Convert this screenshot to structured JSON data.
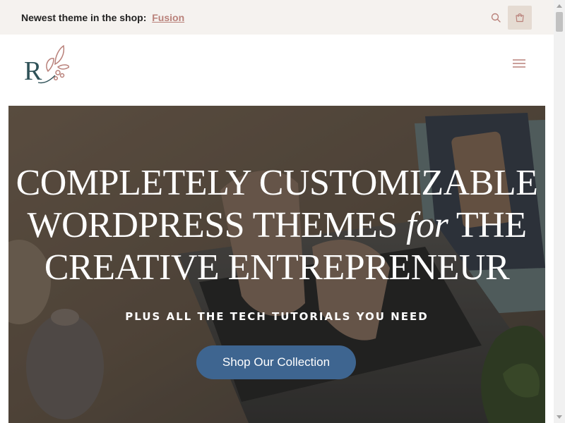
{
  "announcement": {
    "text": "Newest theme in the shop:",
    "link_label": "Fusion"
  },
  "header": {
    "search_icon": "search-icon",
    "cart_icon": "cart-icon",
    "menu_icon": "hamburger-menu-icon",
    "logo_letter": "R"
  },
  "hero": {
    "title_line1": "COMPLETELY CUSTOMIZABLE",
    "title_line2a": "WORDPRESS THEMES",
    "title_line2b": "for",
    "title_line2c": "THE",
    "title_line3": "CREATIVE ENTREPRENEUR",
    "subtitle": "PLUS ALL THE TECH TUTORIALS YOU NEED",
    "cta_label": "Shop Our Collection"
  },
  "colors": {
    "topbar_bg": "#f5f2ef",
    "link": "#b9817a",
    "cart_bg": "#e5dbd2",
    "cta_bg": "#3e6590",
    "logo_teal": "#2f5258",
    "logo_rose": "#b9817a"
  }
}
